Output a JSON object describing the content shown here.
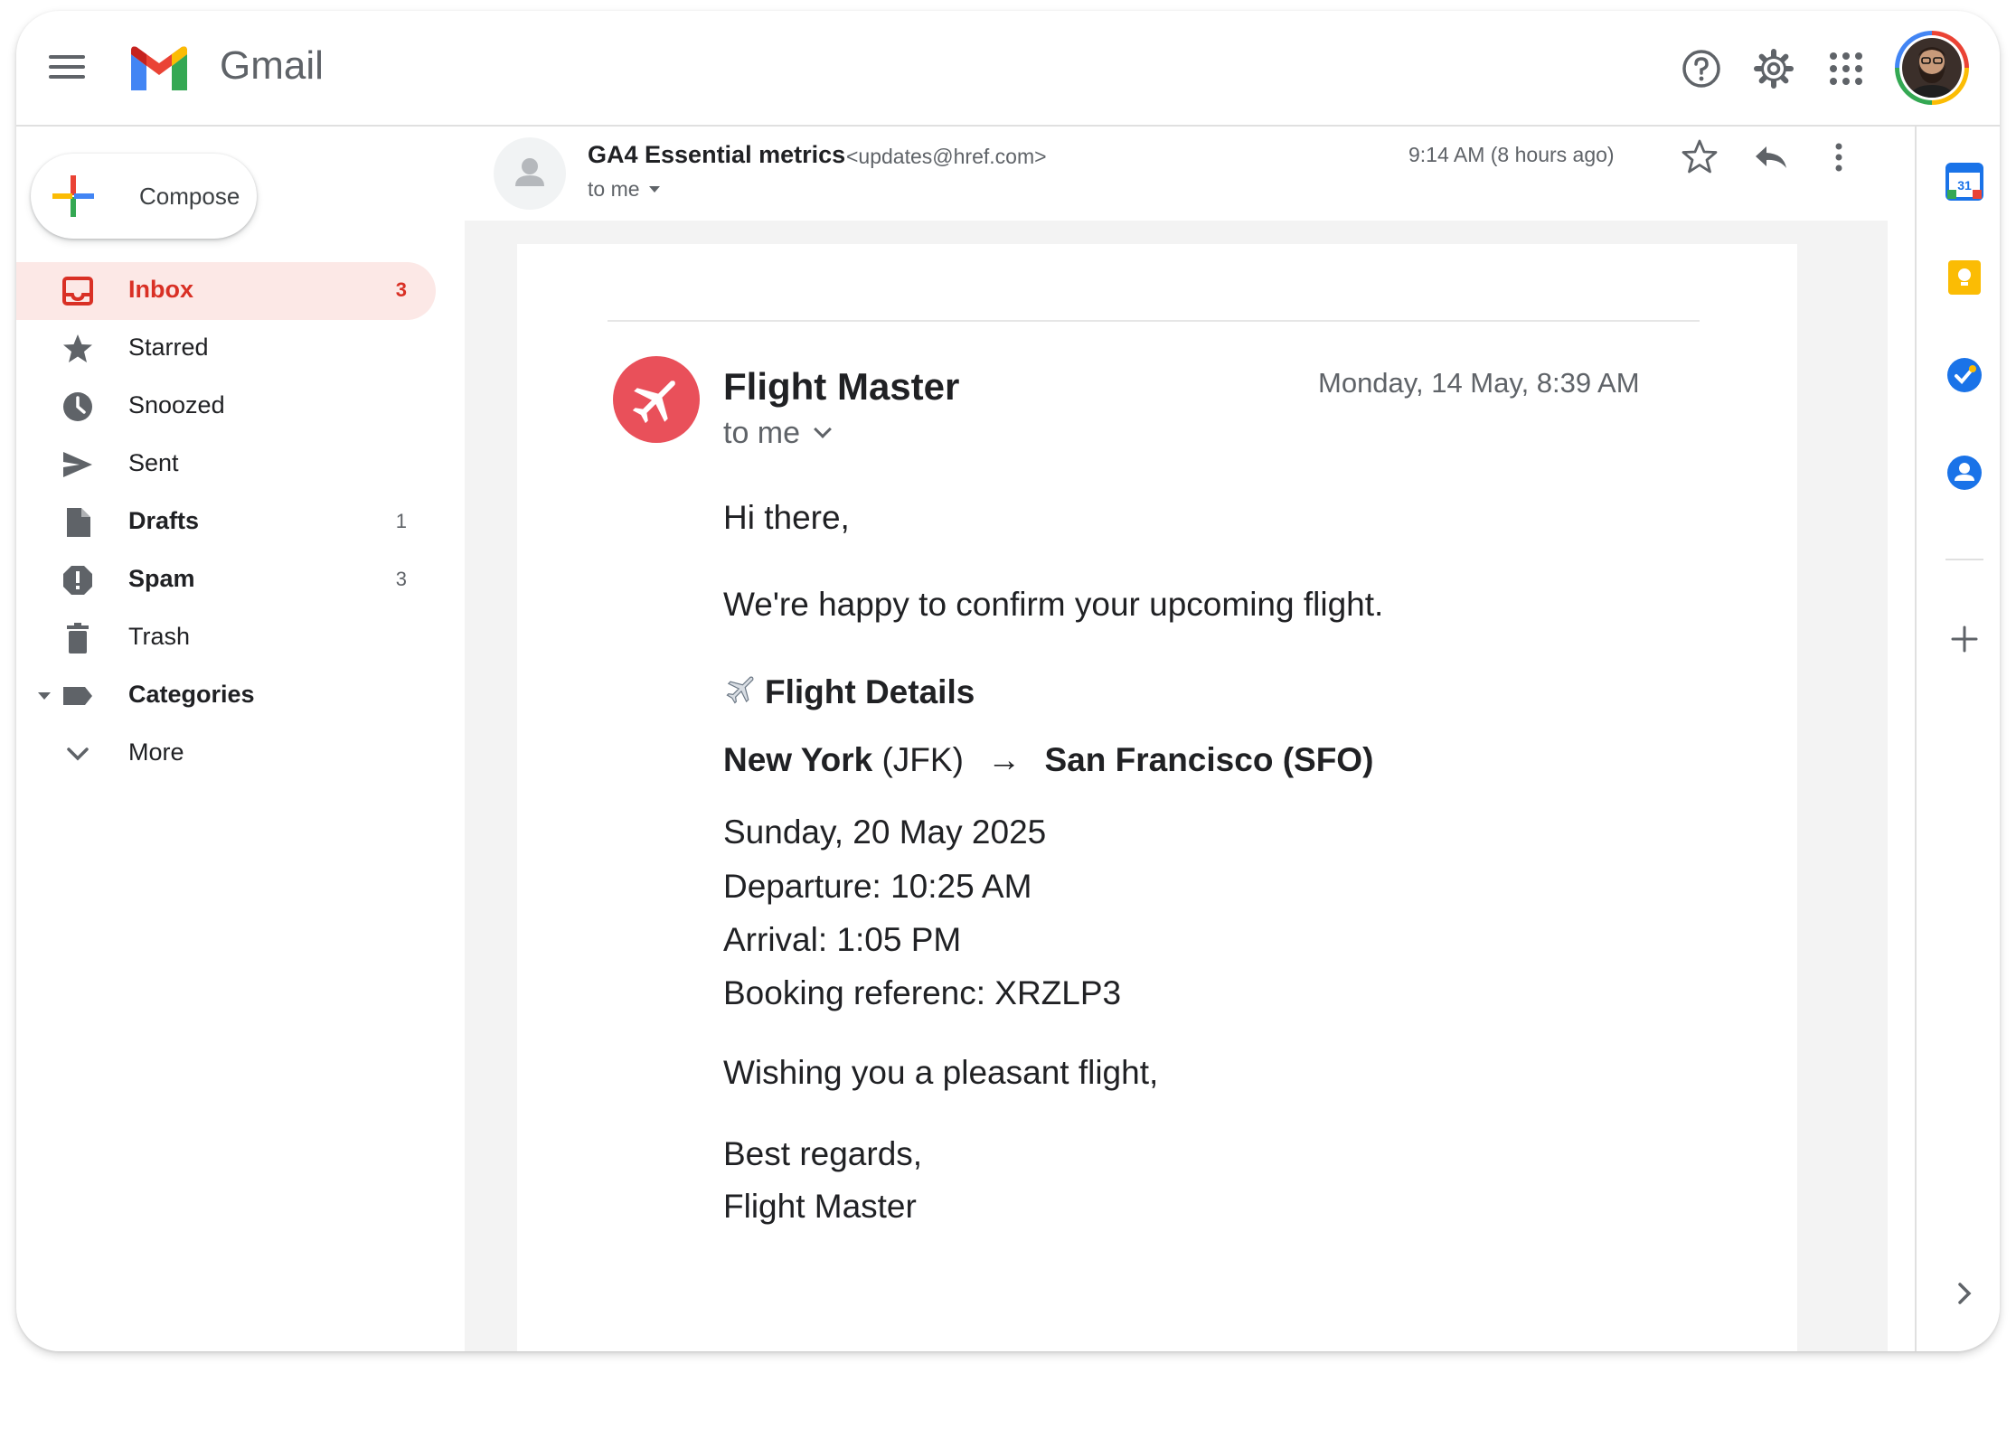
{
  "app": {
    "name": "Gmail"
  },
  "topbar": {
    "icons": [
      "menu-icon",
      "gmail-logo",
      "help-icon",
      "settings-icon",
      "apps-icon",
      "avatar"
    ]
  },
  "sidebar": {
    "compose_label": "Compose",
    "items": [
      {
        "label": "Inbox",
        "count": "3",
        "icon": "inbox-icon",
        "active": true
      },
      {
        "label": "Starred",
        "count": "",
        "icon": "star-icon"
      },
      {
        "label": "Snoozed",
        "count": "",
        "icon": "clock-icon"
      },
      {
        "label": "Sent",
        "count": "",
        "icon": "send-icon"
      },
      {
        "label": "Drafts",
        "count": "1",
        "icon": "draft-icon"
      },
      {
        "label": "Spam",
        "count": "3",
        "icon": "spam-icon"
      },
      {
        "label": "Trash",
        "count": "",
        "icon": "trash-icon"
      },
      {
        "label": "Categories",
        "count": "",
        "icon": "label-icon"
      },
      {
        "label": "More",
        "count": "",
        "icon": "chevron-down-icon"
      }
    ]
  },
  "message": {
    "sender_name": "GA4 Essential metrics",
    "sender_email": "<updates@href.com>",
    "to_label": "to me",
    "time": "9:14 AM  (8 hours ago)"
  },
  "email": {
    "from_name": "Flight Master",
    "date": "Monday, 14 May, 8:39 AM",
    "to_label": "to  me",
    "greeting": "Hi there,",
    "intro": "We're happy to confirm your upcoming flight.",
    "details_heading": "Flight Details",
    "route": {
      "from_city": "New York",
      "from_code": "(JFK)",
      "arrow": "→",
      "to": "San Francisco (SFO)"
    },
    "date_line": "Sunday, 20 May 2025",
    "departure": "Departure: 10:25 AM",
    "arrival": "Arrival: 1:05 PM",
    "booking": "Booking referenc: XRZLP3",
    "wish": "Wishing you a pleasant flight,",
    "signoff": "Best regards,",
    "signature": "Flight Master"
  },
  "right_rail": {
    "calendar_day": "31",
    "icons": [
      "calendar-icon",
      "keep-icon",
      "tasks-icon",
      "contacts-icon",
      "add-icon",
      "chevron-right-icon"
    ]
  },
  "colors": {
    "accent_red": "#d93025",
    "active_bg": "#fce8e6",
    "flight_logo": "#e9505a",
    "calendar_blue": "#1a73e8",
    "keep_yellow": "#fbbc04"
  }
}
